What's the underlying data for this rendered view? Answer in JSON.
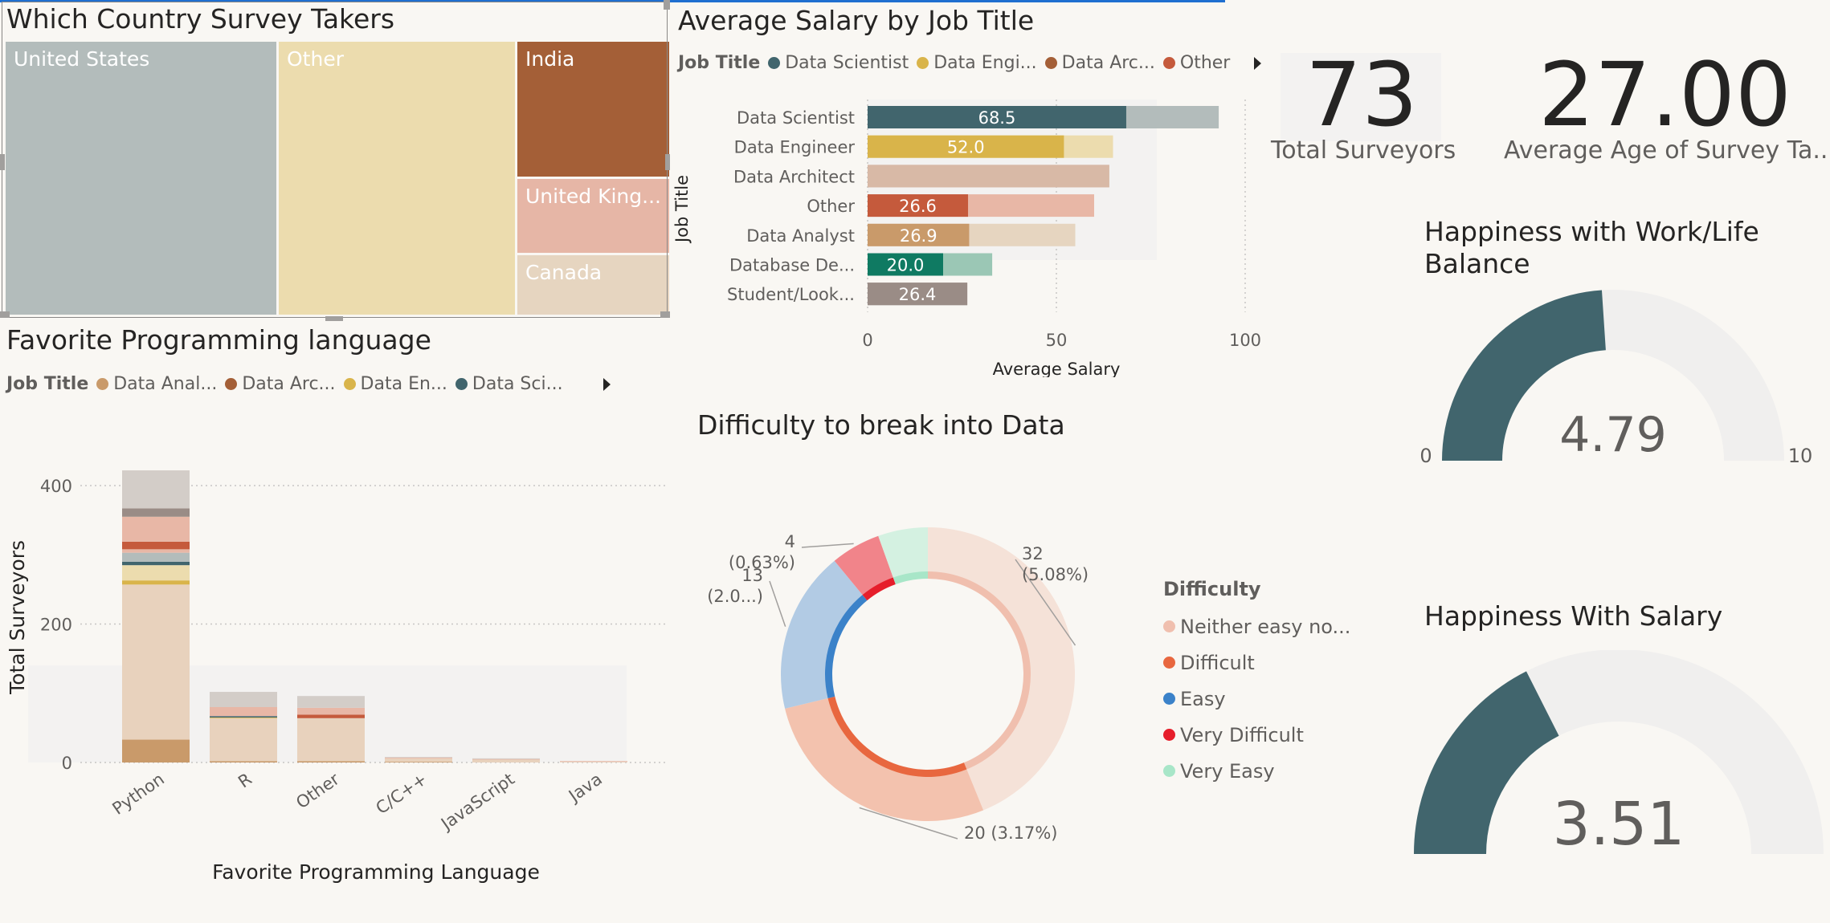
{
  "country_treemap": {
    "title": "Which Country Survey Takers",
    "cells": [
      {
        "label": "United States",
        "color": "#b3bcbb"
      },
      {
        "label": "Other",
        "color": "#ecdcae"
      },
      {
        "label": "India",
        "color": "#a45f37"
      },
      {
        "label": "United King...",
        "color": "#e6b6a6"
      },
      {
        "label": "Canada",
        "color": "#e6d5c0"
      }
    ]
  },
  "salary_chart": {
    "title": "Average Salary by Job Title",
    "legend_title": "Job Title",
    "legend": [
      {
        "label": "Data Scientist",
        "color": "#41656d"
      },
      {
        "label": "Data Engi...",
        "color": "#d9b44a"
      },
      {
        "label": "Data Arc...",
        "color": "#a45f37"
      },
      {
        "label": "Other",
        "color": "#c55a3c"
      }
    ]
  },
  "kpis": {
    "total_surveyors": {
      "value": "73",
      "label": "Total Surveyors"
    },
    "average_age": {
      "value": "27.00",
      "label": "Average Age of Survey Ta..."
    }
  },
  "language_chart": {
    "title": "Favorite Programming language",
    "legend_title": "Job Title",
    "legend": [
      {
        "label": "Data Anal...",
        "color": "#c99a6a"
      },
      {
        "label": "Data Arc...",
        "color": "#a45f37"
      },
      {
        "label": "Data En...",
        "color": "#d9b44a"
      },
      {
        "label": "Data Sci...",
        "color": "#41656d"
      }
    ]
  },
  "difficulty_chart": {
    "title": "Difficulty to break into Data",
    "legend_title": "Difficulty",
    "legend": [
      {
        "label": "Neither easy no...",
        "color": "#f0bfae"
      },
      {
        "label": "Difficult",
        "color": "#e8673f"
      },
      {
        "label": "Easy",
        "color": "#3b82c9"
      },
      {
        "label": "Very Difficult",
        "color": "#e61e2b"
      },
      {
        "label": "Very Easy",
        "color": "#a8e6c8"
      }
    ]
  },
  "gauge_worklife": {
    "title_line1": "Happiness with Work/Life",
    "title_line2": "Balance",
    "value": "4.79",
    "min": "0",
    "max": "10"
  },
  "gauge_salary": {
    "title": "Happiness With Salary",
    "value": "3.51",
    "min": "0",
    "max": "10"
  },
  "chart_data": [
    {
      "type": "bar",
      "orientation": "horizontal",
      "title": "Average Salary by Job Title",
      "xlabel": "Average Salary",
      "ylabel": "Job Title",
      "xlim": [
        0,
        100
      ],
      "xticks": [
        "0",
        "50",
        "100"
      ],
      "categories": [
        "Data Scientist",
        "Data Engineer",
        "Data Architect",
        "Other",
        "Data Analyst",
        "Database De...",
        "Student/Look..."
      ],
      "values": [
        68.5,
        52.0,
        64,
        26.6,
        26.9,
        20.0,
        26.4
      ],
      "background_values": [
        93,
        65,
        64,
        60,
        55,
        33,
        26.4
      ],
      "labels": [
        "68.5",
        "52.0",
        "",
        "26.6",
        "26.9",
        "20.0",
        "26.4"
      ],
      "colors": [
        "#41656d",
        "#d9b44a",
        "#d8b9a6",
        "#c55a3c",
        "#c99a6a",
        "#0f7a62",
        "#9a8c86"
      ],
      "light_colors": [
        "#b3bcbb",
        "#ecdcae",
        "#d8b9a6",
        "#e8b7a6",
        "#e6d5c0",
        "#9bc7b5",
        "#9a8c86"
      ],
      "grid": true
    },
    {
      "type": "bar",
      "stacked": true,
      "title": "Favorite Programming language",
      "xlabel": "Favorite Programming Language",
      "ylabel": "Total Surveyors",
      "ylim": [
        0,
        450
      ],
      "yticks": [
        "0",
        "200",
        "400"
      ],
      "categories": [
        "Python",
        "R",
        "Other",
        "C/C++",
        "JavaScript",
        "Java"
      ],
      "totals": [
        422,
        102,
        96,
        8,
        6,
        2
      ],
      "series": [
        {
          "color": "#c99a6a",
          "values": [
            33,
            2,
            2,
            1,
            0,
            0
          ]
        },
        {
          "color": "#e8d2bd",
          "values": [
            224,
            62,
            62,
            5,
            4,
            1
          ]
        },
        {
          "color": "#d9b44a",
          "values": [
            6,
            1,
            0,
            0,
            0,
            0
          ]
        },
        {
          "color": "#ecdcae",
          "values": [
            22,
            0,
            0,
            0,
            0,
            0
          ]
        },
        {
          "color": "#41656d",
          "values": [
            5,
            2,
            0,
            0,
            0,
            0
          ]
        },
        {
          "color": "#b3bcbb",
          "values": [
            13,
            0,
            0,
            0,
            0,
            0
          ]
        },
        {
          "color": "#e8b7a6",
          "values": [
            5,
            0,
            0,
            0,
            0,
            0
          ]
        },
        {
          "color": "#c55a3c",
          "values": [
            11,
            0,
            5,
            0,
            0,
            0
          ]
        },
        {
          "color": "#e8b7a6",
          "values": [
            36,
            13,
            10,
            1,
            1,
            1
          ]
        },
        {
          "color": "#9a8c86",
          "values": [
            12,
            0,
            0,
            0,
            0,
            0
          ]
        },
        {
          "color": "#d3cdc8",
          "values": [
            55,
            22,
            17,
            1,
            1,
            0
          ]
        }
      ],
      "grid": true
    },
    {
      "type": "pie",
      "donut": true,
      "title": "Difficulty to break into Data",
      "legend_title": "Difficulty",
      "categories": [
        "Neither easy no...",
        "Difficult",
        "Easy",
        "Very Difficult",
        "Very Easy"
      ],
      "values": [
        32,
        20,
        13,
        4,
        4
      ],
      "colors": [
        "#f0bfae",
        "#e8673f",
        "#3b82c9",
        "#e61e2b",
        "#a8e6c8"
      ],
      "outer_colors": [
        "#f5e2d8",
        "#f3c2ae",
        "#b2cbe4",
        "#f1848a",
        "#d4f1e1"
      ],
      "data_labels": [
        {
          "line1": "32",
          "line2": "(5.08%)"
        },
        {
          "line1": "20 (3.17%)",
          "line2": ""
        },
        {
          "line1": "13",
          "line2": "(2.0...)"
        },
        {
          "line1": "4",
          "line2": "(0.63%)"
        }
      ],
      "legend_position": "right"
    },
    {
      "type": "gauge",
      "title": "Happiness with Work/Life Balance",
      "value": 4.79,
      "min": 0,
      "max": 10,
      "color": "#41656d"
    },
    {
      "type": "gauge",
      "title": "Happiness With Salary",
      "value": 3.51,
      "min": 0,
      "max": 10,
      "color": "#41656d"
    }
  ]
}
